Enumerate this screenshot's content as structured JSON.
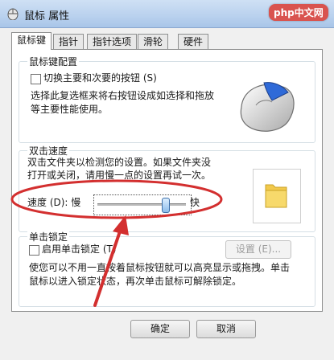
{
  "window": {
    "title": "鼠标 属性",
    "watermark": "php中文网"
  },
  "tabs": [
    {
      "label": "鼠标键"
    },
    {
      "label": "指针"
    },
    {
      "label": "指针选项"
    },
    {
      "label": "滑轮"
    },
    {
      "label": "硬件"
    }
  ],
  "button_config": {
    "title": "鼠标键配置",
    "switch_label": "切换主要和次要的按钮 (S)",
    "desc_line1": "选择此复选框来将右按钮设成如选择和拖放",
    "desc_line2": "等主要性能使用。"
  },
  "double_click": {
    "title": "双击速度",
    "desc_line1": "双击文件夹以检测您的设置。如果文件夹没",
    "desc_line2": "打开或关闭，请用慢一点的设置再试一次。",
    "speed_label": "速度 (D): 慢",
    "fast_label": "快",
    "speed_value": 0.8
  },
  "click_lock": {
    "title": "单击锁定",
    "enable_label": "启用单击锁定 (T)",
    "settings_button": "设置 (E)...",
    "desc_line1": "使您可以不用一直按着鼠标按钮就可以高亮显示或拖拽。单击",
    "desc_line2": "鼠标以进入锁定状态，再次单击鼠标可解除锁定。"
  },
  "footer": {
    "ok_button": "确定",
    "cancel_button": "取消"
  },
  "colors": {
    "annotation": "#d32f2f",
    "titlebar": "#b9d1ee",
    "slider_thumb": "#4a8fd8"
  }
}
